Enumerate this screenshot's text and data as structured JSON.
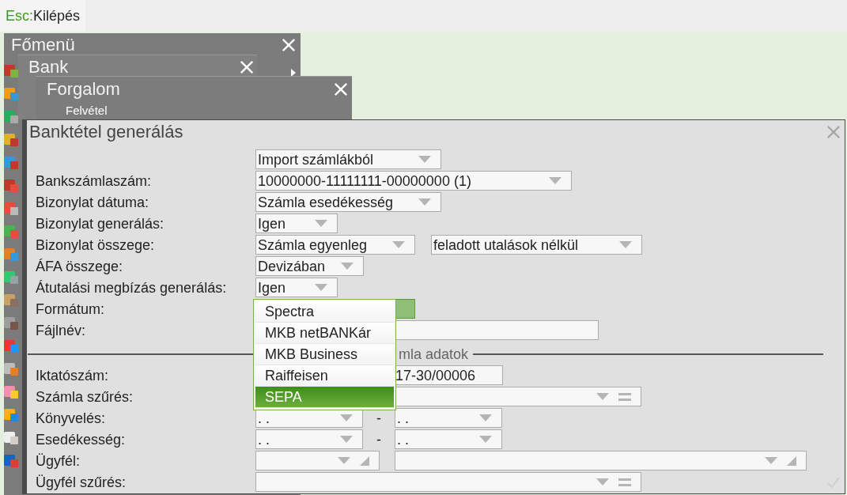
{
  "topbar": {
    "key": "Esc:",
    "label": "Kilépés"
  },
  "windows": [
    {
      "title": "Főmenü"
    },
    {
      "title": "Bank"
    },
    {
      "title": "Forgalom",
      "items": [
        "Felvétel"
      ]
    }
  ],
  "dialog": {
    "title": "Banktétel generálás",
    "source": {
      "value": "Import számlákból"
    },
    "fields": [
      {
        "label": "Bankszámlaszám:",
        "value": "10000000-11111111-00000000 (1)"
      },
      {
        "label": "Bizonylat dátuma:",
        "value": "Számla esedékesség"
      },
      {
        "label": "Bizonylat generálás:",
        "value": "Igen"
      },
      {
        "label": "Bizonylat összege:",
        "value": "Számla egyenleg",
        "value2": "feladott utalások nélkül"
      },
      {
        "label": "ÁFA összege:",
        "value": "Devizában"
      },
      {
        "label": "Átutalási megbízás generálás:",
        "value": "Igen"
      },
      {
        "label": "Formátum:"
      },
      {
        "label": "Fájlnév:"
      }
    ],
    "section": "mla adatok",
    "invoice_fields": [
      {
        "label": "Iktatószám:",
        "value": "17-30/00006"
      },
      {
        "label": "Számla szűrés:"
      },
      {
        "label": "Könyvelés:",
        "from": ". .",
        "separator": "-",
        "to": ". ."
      },
      {
        "label": "Esedékesség:",
        "from": ". .",
        "separator": "-",
        "to": ". ."
      },
      {
        "label": "Ügyfél:"
      },
      {
        "label": "Ügyfél szűrés:"
      }
    ],
    "format_dropdown": {
      "options": [
        {
          "label": "Spectra",
          "selected": false
        },
        {
          "label": "MKB netBANKár",
          "selected": false
        },
        {
          "label": "MKB Business",
          "selected": false
        },
        {
          "label": "Raiffeisen",
          "selected": false
        },
        {
          "label": "SEPA",
          "selected": true
        }
      ]
    }
  }
}
